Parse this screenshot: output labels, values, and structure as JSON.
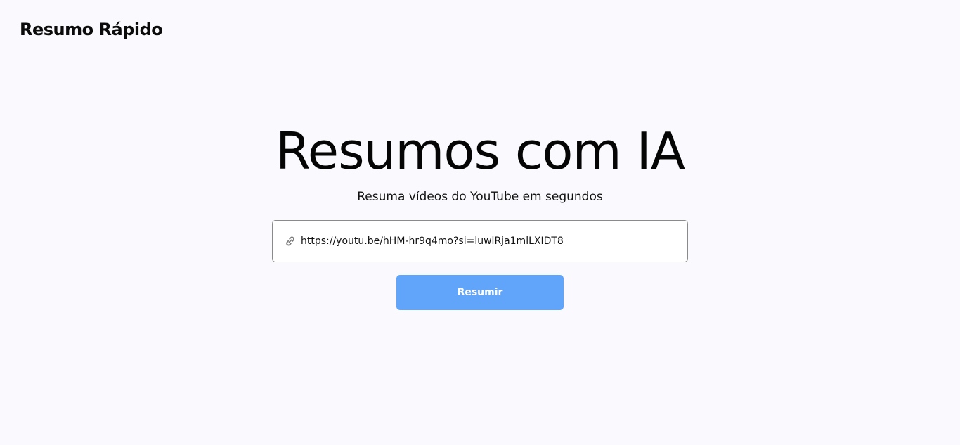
{
  "header": {
    "brand": "Resumo Rápido"
  },
  "hero": {
    "title": "Resumos com IA",
    "subtitle": "Resuma vídeos do YouTube em segundos"
  },
  "form": {
    "url_value": "https://youtu.be/hHM-hr9q4mo?si=luwlRja1mlLXIDT8",
    "link_icon": "link-icon",
    "submit_label": "Resumir"
  },
  "colors": {
    "background": "#fafafe",
    "button": "#60a5fa",
    "border": "#8a8a8a"
  }
}
